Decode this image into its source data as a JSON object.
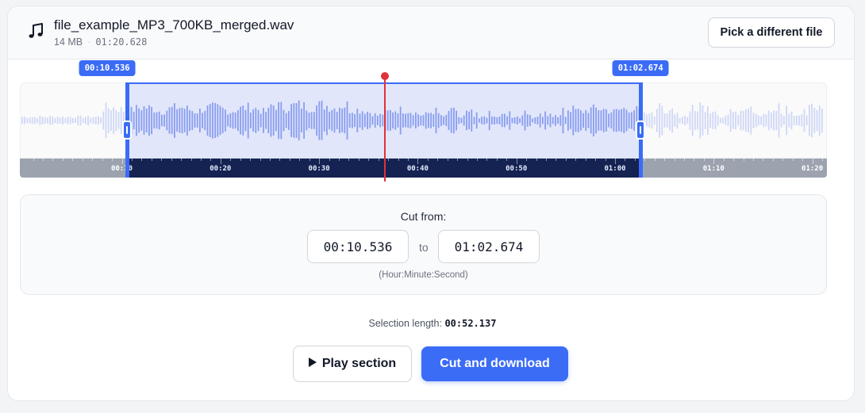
{
  "file": {
    "icon": "music-note-icon",
    "name": "file_example_MP3_700KB_merged.wav",
    "size": "14 MB",
    "separator": "·",
    "duration": "01:20.628",
    "duration_seconds": 80.628
  },
  "header": {
    "pick_label": "Pick a different file"
  },
  "waveform": {
    "selection_start": "00:10.536",
    "selection_end": "01:02.674",
    "selection_start_seconds": 10.536,
    "selection_end_seconds": 62.674,
    "playhead_seconds": 36.7,
    "timeline_ticks": [
      "00:10",
      "00:20",
      "00:30",
      "00:40",
      "00:50",
      "01:00",
      "01:10",
      "01:20"
    ],
    "colors": {
      "accent": "#3b6cf6",
      "playhead": "#e0323a",
      "wave_in_selection": "#93a6ee",
      "wave_outside": "#cfd7f5"
    }
  },
  "cut": {
    "title": "Cut from:",
    "from_value": "00:10.536",
    "to_label": "to",
    "to_value": "01:02.674",
    "hint": "(Hour:Minute:Second)"
  },
  "selection_length": {
    "label": "Selection length:",
    "value": "00:52.137"
  },
  "actions": {
    "play_label": "Play section",
    "cut_label": "Cut and download"
  }
}
